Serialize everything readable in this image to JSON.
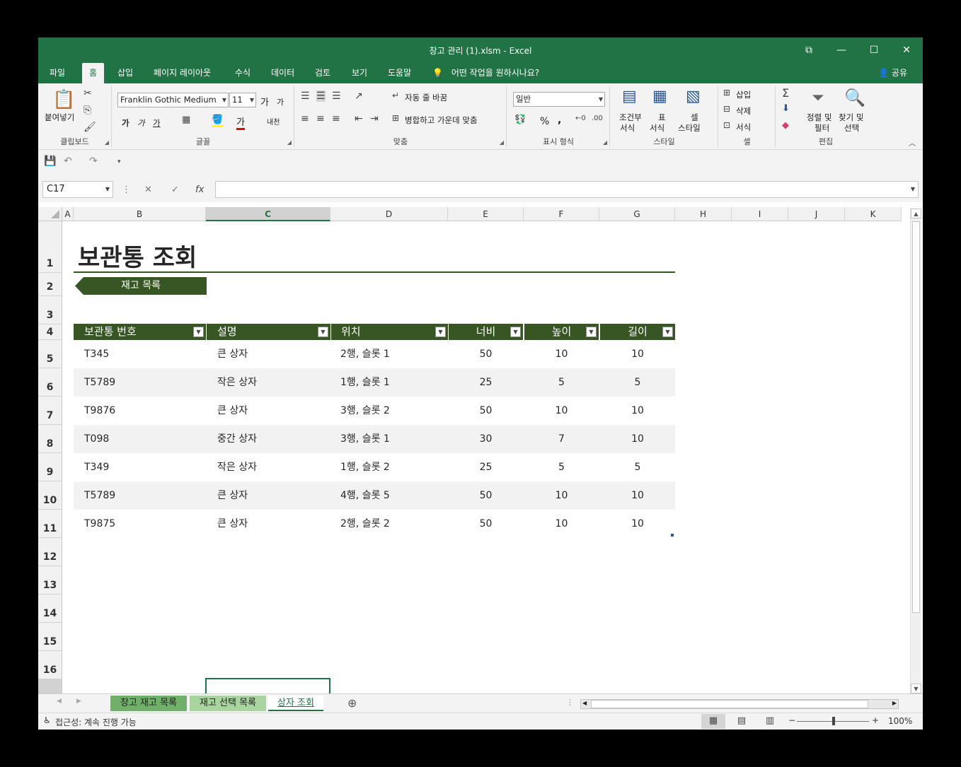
{
  "window": {
    "title": "창고 관리 (1).xlsm  -  Excel",
    "controls": {
      "restore_ribbon": "⧉",
      "minimize": "—",
      "maximize": "☐",
      "close": "✕"
    }
  },
  "ribbon_tabs": [
    "파일",
    "홈",
    "삽입",
    "페이지 레이아웃",
    "수식",
    "데이터",
    "검토",
    "보기",
    "도움말"
  ],
  "active_tab": "홈",
  "tell_me": "어떤 작업을 원하시나요?",
  "share": "공유",
  "ribbon": {
    "clipboard": {
      "paste": "붙여넣기",
      "label": "클립보드"
    },
    "font": {
      "name": "Franklin Gothic Medium",
      "size": "11",
      "label": "글꼴",
      "grow": "가",
      "shrink": "가",
      "bold": "가",
      "italic": "가",
      "underline": "가",
      "font_color_glyph": "가",
      "phonetic": "내천"
    },
    "alignment": {
      "wrap": "자동 줄 바꿈",
      "merge": "병합하고 가운데 맞춤",
      "label": "맞춤"
    },
    "number": {
      "format": "일반",
      "label": "표시 형식",
      "percent": "%",
      "comma": ","
    },
    "styles": {
      "conditional_1": "조건부",
      "conditional_2": "서식",
      "table_1": "표",
      "table_2": "서식",
      "cell_1": "셀",
      "cell_2": "스타일",
      "label": "스타일"
    },
    "cells": {
      "insert": "삽입",
      "delete": "삭제",
      "format": "서식",
      "label": "셀"
    },
    "editing": {
      "sort_1": "정렬 및",
      "sort_2": "필터",
      "find_1": "찾기 및",
      "find_2": "선택",
      "label": "편집"
    }
  },
  "name_box": "C17",
  "fx": "fx",
  "columns": [
    "A",
    "B",
    "C",
    "D",
    "E",
    "F",
    "G",
    "H",
    "I",
    "J",
    "K"
  ],
  "rows": [
    "1",
    "2",
    "3",
    "4",
    "5",
    "6",
    "7",
    "8",
    "9",
    "10",
    "11",
    "12",
    "13",
    "14",
    "15",
    "16"
  ],
  "sheet": {
    "title": "보관통 조회",
    "nav_button": "재고 목록",
    "table_headers": [
      "보관통 번호",
      "설명",
      "위치",
      "너비",
      "높이",
      "길이"
    ],
    "table_rows": [
      [
        "T345",
        "큰 상자",
        "2행, 슬롯 1",
        "50",
        "10",
        "10"
      ],
      [
        "T5789",
        "작은 상자",
        "1행, 슬롯 1",
        "25",
        "5",
        "5"
      ],
      [
        "T9876",
        "큰 상자",
        "3행, 슬롯 2",
        "50",
        "10",
        "10"
      ],
      [
        "T098",
        "중간 상자",
        "3행, 슬롯 1",
        "30",
        "7",
        "10"
      ],
      [
        "T349",
        "작은 상자",
        "1행, 슬롯 2",
        "25",
        "5",
        "5"
      ],
      [
        "T5789",
        "큰 상자",
        "4행, 슬롯 5",
        "50",
        "10",
        "10"
      ],
      [
        "T9875",
        "큰 상자",
        "2행, 슬롯 2",
        "50",
        "10",
        "10"
      ]
    ]
  },
  "sheet_tabs": [
    "창고 재고 목록",
    "재고 선택 목록",
    "상자 조회"
  ],
  "active_sheet": "상자 조회",
  "status": {
    "accessibility": "접근성: 계속 진행 가능",
    "zoom": "100%",
    "zoom_minus": "−",
    "zoom_plus": "+"
  },
  "colors": {
    "excel_green": "#217346",
    "table_header": "#375623",
    "band": "#f2f2f2"
  }
}
